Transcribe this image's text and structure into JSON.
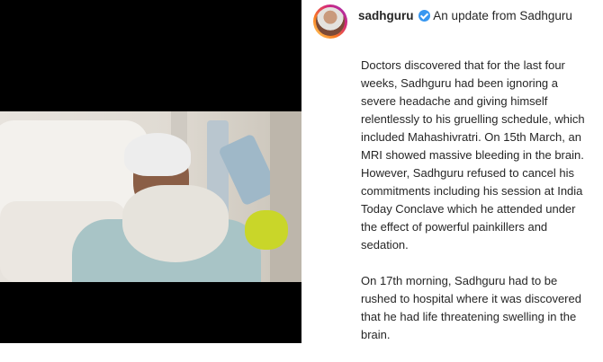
{
  "post": {
    "username": "sadhguru",
    "header_text": "An update from Sadhguru",
    "verified_icon": "verified-badge-icon",
    "avatar_icon": "profile-avatar",
    "caption_paragraphs": [
      "Doctors discovered that for the last four weeks, Sadhguru had been ignoring a severe headache and giving himself relentlessly to his gruelling schedule, which included Mahashivratri. On 15th March, an MRI showed massive bleeding in the brain. However, Sadhguru refused to cancel his commitments including his session at India Today Conclave which he attended under the effect of powerful painkillers and sedation.",
      "On 17th morning, Sadhguru had to be rushed to hospital where it was discovered that he had life threatening swelling in the brain."
    ]
  },
  "colors": {
    "text": "#262626",
    "verified": "#3897f0",
    "media_background": "#000000"
  }
}
